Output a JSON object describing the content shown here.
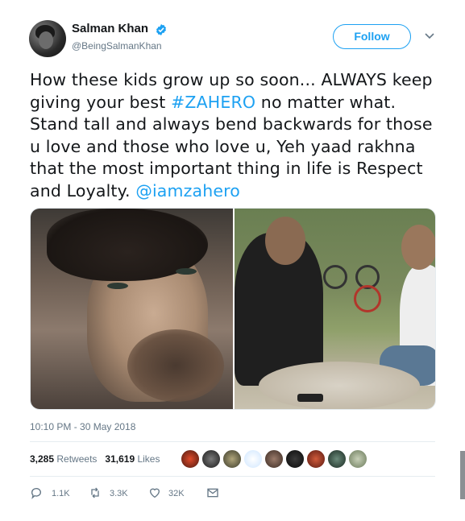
{
  "user": {
    "name": "Salman Khan",
    "handle": "@BeingSalmanKhan",
    "verified": true
  },
  "follow_label": "Follow",
  "tweet": {
    "segments": [
      {
        "text": "How these kids grow up so soon... ALWAYS keep giving your best ",
        "link": false
      },
      {
        "text": "#ZAHERO",
        "link": true
      },
      {
        "text": "  no matter what. Stand tall and always bend backwards for those u love  and those who love u, Yeh yaad rakhna that the most important thing in life is Respect and Loyalty. ",
        "link": false
      },
      {
        "text": "@iamzahero",
        "link": true
      }
    ]
  },
  "timestamp": "10:10 PM - 30 May 2018",
  "stats": {
    "retweets_count": "3,285",
    "retweets_label": "Retweets",
    "likes_count": "31,619",
    "likes_label": "Likes"
  },
  "actions": {
    "reply_count": "1.1K",
    "retweet_count": "3.3K",
    "like_count": "32K"
  },
  "colors": {
    "accent": "#1da1f2",
    "text": "#14171a",
    "muted": "#657786",
    "divider": "#e6ecf0"
  },
  "icons": [
    "verified-badge-icon",
    "chevron-down-icon",
    "reply-icon",
    "retweet-icon",
    "heart-icon",
    "mail-icon"
  ]
}
